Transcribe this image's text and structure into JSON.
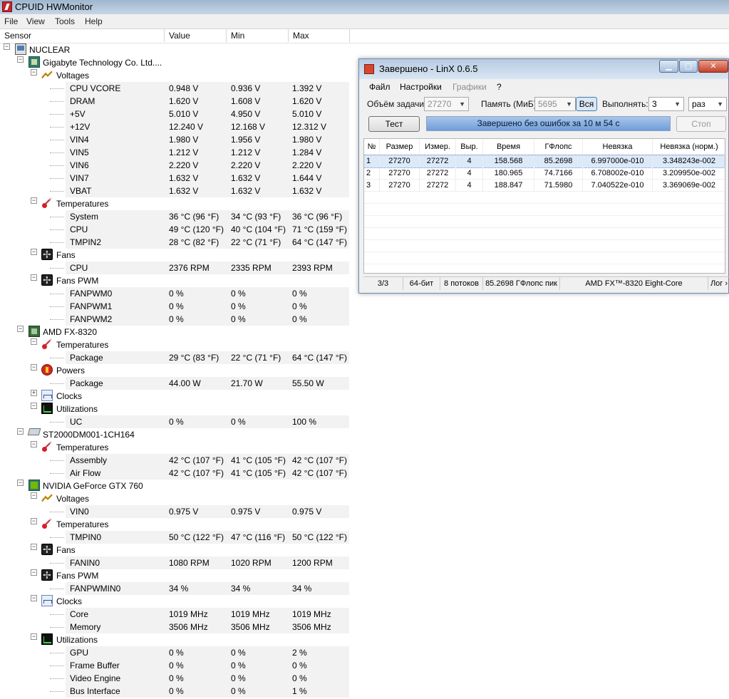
{
  "hwmonitor": {
    "title": "CPUID HWMonitor",
    "menu": [
      "File",
      "View",
      "Tools",
      "Help"
    ],
    "columns": [
      "Sensor",
      "Value",
      "Min",
      "Max"
    ],
    "rows": [
      {
        "label": "NUCLEAR",
        "level": 0,
        "icon": "computer-icon",
        "expander": "-"
      },
      {
        "label": "Gigabyte Technology Co. Ltd....",
        "level": 1,
        "icon": "motherboard-icon",
        "expander": "-"
      },
      {
        "label": "Voltages",
        "level": 2,
        "icon": "voltage-icon",
        "expander": "-"
      },
      {
        "label": "CPU VCORE",
        "level": 3,
        "value": "0.948 V",
        "min": "0.936 V",
        "max": "1.392 V"
      },
      {
        "label": "DRAM",
        "level": 3,
        "value": "1.620 V",
        "min": "1.608 V",
        "max": "1.620 V"
      },
      {
        "label": "+5V",
        "level": 3,
        "value": "5.010 V",
        "min": "4.950 V",
        "max": "5.010 V"
      },
      {
        "label": "+12V",
        "level": 3,
        "value": "12.240 V",
        "min": "12.168 V",
        "max": "12.312 V"
      },
      {
        "label": "VIN4",
        "level": 3,
        "value": "1.980 V",
        "min": "1.956 V",
        "max": "1.980 V"
      },
      {
        "label": "VIN5",
        "level": 3,
        "value": "1.212 V",
        "min": "1.212 V",
        "max": "1.284 V"
      },
      {
        "label": "VIN6",
        "level": 3,
        "value": "2.220 V",
        "min": "2.220 V",
        "max": "2.220 V"
      },
      {
        "label": "VIN7",
        "level": 3,
        "value": "1.632 V",
        "min": "1.632 V",
        "max": "1.644 V"
      },
      {
        "label": "VBAT",
        "level": 3,
        "value": "1.632 V",
        "min": "1.632 V",
        "max": "1.632 V"
      },
      {
        "label": "Temperatures",
        "level": 2,
        "icon": "thermometer-icon",
        "expander": "-"
      },
      {
        "label": "System",
        "level": 3,
        "value": "36 °C  (96 °F)",
        "min": "34 °C  (93 °F)",
        "max": "36 °C  (96 °F)"
      },
      {
        "label": "CPU",
        "level": 3,
        "value": "49 °C  (120 °F)",
        "min": "40 °C  (104 °F)",
        "max": "71 °C  (159 °F)"
      },
      {
        "label": "TMPIN2",
        "level": 3,
        "value": "28 °C  (82 °F)",
        "min": "22 °C  (71 °F)",
        "max": "64 °C  (147 °F)"
      },
      {
        "label": "Fans",
        "level": 2,
        "icon": "fan-icon",
        "expander": "-"
      },
      {
        "label": "CPU",
        "level": 3,
        "value": "2376 RPM",
        "min": "2335 RPM",
        "max": "2393 RPM"
      },
      {
        "label": "Fans PWM",
        "level": 2,
        "icon": "fan-pwm-icon",
        "expander": "-"
      },
      {
        "label": "FANPWM0",
        "level": 3,
        "value": "0 %",
        "min": "0 %",
        "max": "0 %"
      },
      {
        "label": "FANPWM1",
        "level": 3,
        "value": "0 %",
        "min": "0 %",
        "max": "0 %"
      },
      {
        "label": "FANPWM2",
        "level": 3,
        "value": "0 %",
        "min": "0 %",
        "max": "0 %"
      },
      {
        "label": "AMD FX-8320",
        "level": 1,
        "icon": "cpu-icon",
        "expander": "-"
      },
      {
        "label": "Temperatures",
        "level": 2,
        "icon": "thermometer-icon",
        "expander": "-"
      },
      {
        "label": "Package",
        "level": 3,
        "value": "29 °C  (83 °F)",
        "min": "22 °C  (71 °F)",
        "max": "64 °C  (147 °F)"
      },
      {
        "label": "Powers",
        "level": 2,
        "icon": "power-icon",
        "expander": "-"
      },
      {
        "label": "Package",
        "level": 3,
        "value": "44.00 W",
        "min": "21.70 W",
        "max": "55.50 W"
      },
      {
        "label": "Clocks",
        "level": 2,
        "icon": "clock-icon",
        "expander": "+"
      },
      {
        "label": "Utilizations",
        "level": 2,
        "icon": "utilization-icon",
        "expander": "-"
      },
      {
        "label": "UC",
        "level": 3,
        "value": "0 %",
        "min": "0 %",
        "max": "100 %"
      },
      {
        "label": "ST2000DM001-1CH164",
        "level": 1,
        "icon": "hard-drive-icon",
        "expander": "-"
      },
      {
        "label": "Temperatures",
        "level": 2,
        "icon": "thermometer-icon",
        "expander": "-"
      },
      {
        "label": "Assembly",
        "level": 3,
        "value": "42 °C  (107 °F)",
        "min": "41 °C  (105 °F)",
        "max": "42 °C  (107 °F)"
      },
      {
        "label": "Air Flow",
        "level": 3,
        "value": "42 °C  (107 °F)",
        "min": "41 °C  (105 °F)",
        "max": "42 °C  (107 °F)"
      },
      {
        "label": "NVIDIA GeForce GTX 760",
        "level": 1,
        "icon": "gpu-icon",
        "expander": "-"
      },
      {
        "label": "Voltages",
        "level": 2,
        "icon": "voltage-icon",
        "expander": "-"
      },
      {
        "label": "VIN0",
        "level": 3,
        "value": "0.975 V",
        "min": "0.975 V",
        "max": "0.975 V"
      },
      {
        "label": "Temperatures",
        "level": 2,
        "icon": "thermometer-icon",
        "expander": "-"
      },
      {
        "label": "TMPIN0",
        "level": 3,
        "value": "50 °C  (122 °F)",
        "min": "47 °C  (116 °F)",
        "max": "50 °C  (122 °F)"
      },
      {
        "label": "Fans",
        "level": 2,
        "icon": "fan-icon",
        "expander": "-"
      },
      {
        "label": "FANIN0",
        "level": 3,
        "value": "1080 RPM",
        "min": "1020 RPM",
        "max": "1200 RPM"
      },
      {
        "label": "Fans PWM",
        "level": 2,
        "icon": "fan-pwm-icon",
        "expander": "-"
      },
      {
        "label": "FANPWMIN0",
        "level": 3,
        "value": "34 %",
        "min": "34 %",
        "max": "34 %"
      },
      {
        "label": "Clocks",
        "level": 2,
        "icon": "clock-icon",
        "expander": "-"
      },
      {
        "label": "Core",
        "level": 3,
        "value": "1019 MHz",
        "min": "1019 MHz",
        "max": "1019 MHz"
      },
      {
        "label": "Memory",
        "level": 3,
        "value": "3506 MHz",
        "min": "3506 MHz",
        "max": "3506 MHz"
      },
      {
        "label": "Utilizations",
        "level": 2,
        "icon": "utilization-icon",
        "expander": "-"
      },
      {
        "label": "GPU",
        "level": 3,
        "value": "0 %",
        "min": "0 %",
        "max": "2 %"
      },
      {
        "label": "Frame Buffer",
        "level": 3,
        "value": "0 %",
        "min": "0 %",
        "max": "0 %"
      },
      {
        "label": "Video Engine",
        "level": 3,
        "value": "0 %",
        "min": "0 %",
        "max": "0 %"
      },
      {
        "label": "Bus Interface",
        "level": 3,
        "value": "0 %",
        "min": "0 %",
        "max": "1 %"
      }
    ]
  },
  "linx": {
    "title": "Завершено - LinX 0.6.5",
    "menu": {
      "file": "Файл",
      "settings": "Настройки",
      "graphs": "Графики",
      "help": "?"
    },
    "task_label": "Объём задачи:",
    "task_value": "27270",
    "memory_label": "Память (МиБ):",
    "memory_value": "5695",
    "all_button": "Вся",
    "run_label": "Выполнять:",
    "run_value": "3",
    "run_unit": "раз",
    "test_button": "Тест",
    "status_message": "Завершено без ошибок за 10 м 54 с",
    "stop_button": "Стоп",
    "columns": [
      "№",
      "Размер",
      "Измер.",
      "Выр.",
      "Время",
      "ГФлопс",
      "Невязка",
      "Невязка (норм.)"
    ],
    "results": [
      [
        "1",
        "27270",
        "27272",
        "4",
        "158.568",
        "85.2698",
        "6.997000e-010",
        "3.348243e-002"
      ],
      [
        "2",
        "27270",
        "27272",
        "4",
        "180.965",
        "74.7166",
        "6.708002e-010",
        "3.209950e-002"
      ],
      [
        "3",
        "27270",
        "27272",
        "4",
        "188.847",
        "71.5980",
        "7.040522e-010",
        "3.369069e-002"
      ]
    ],
    "statusbar": {
      "progress": "3/3",
      "bits": "64-бит",
      "threads": "8 потоков",
      "peak": "85.2698 ГФлопс пик",
      "cpu": "AMD FX™-8320 Eight-Core",
      "log": "Лог ›"
    }
  }
}
